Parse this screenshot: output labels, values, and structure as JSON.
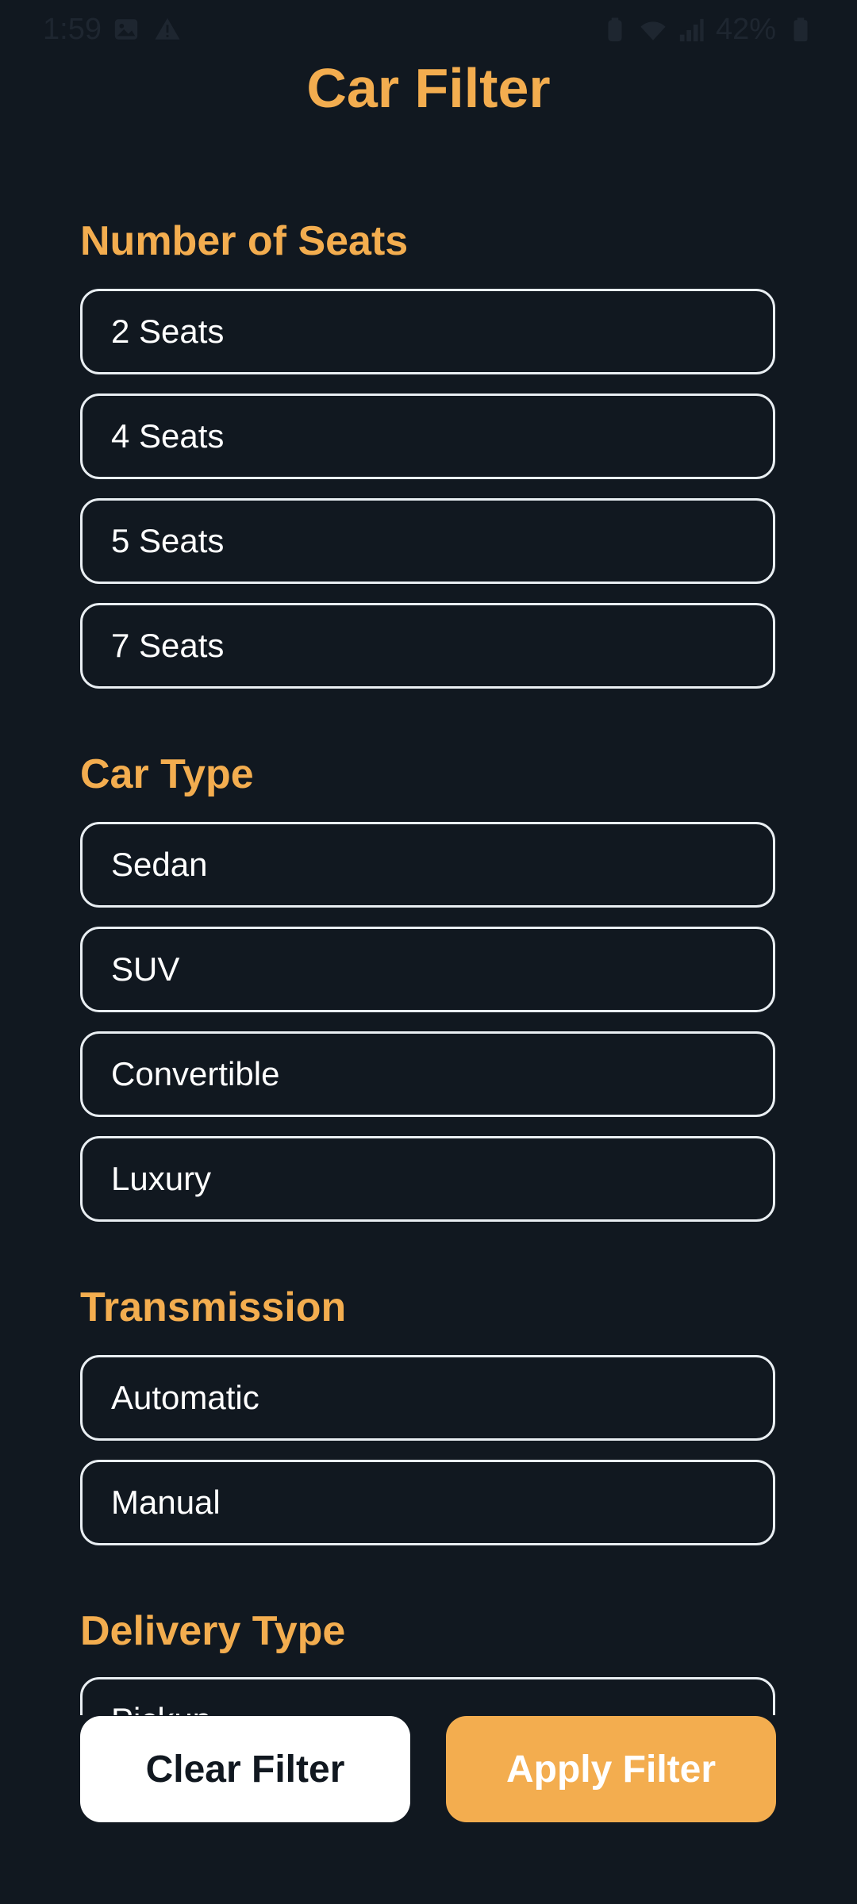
{
  "status_bar": {
    "time": "1:59",
    "battery": "42%"
  },
  "page": {
    "title": "Car Filter"
  },
  "sections": {
    "seats": {
      "heading": "Number of Seats",
      "options": [
        "2 Seats",
        "4 Seats",
        "5 Seats",
        "7 Seats"
      ]
    },
    "car_type": {
      "heading": "Car Type",
      "options": [
        "Sedan",
        "SUV",
        "Convertible",
        "Luxury"
      ]
    },
    "transmission": {
      "heading": "Transmission",
      "options": [
        "Automatic",
        "Manual"
      ]
    },
    "delivery": {
      "heading": "Delivery Type",
      "options": [
        "Pickup"
      ]
    }
  },
  "footer": {
    "clear_label": "Clear Filter",
    "apply_label": "Apply Filter"
  },
  "colors": {
    "background": "#111820",
    "accent": "#f3ad4f",
    "border": "#e9eef2"
  },
  "icons": [
    "image-icon",
    "warning-icon",
    "battery-saver-icon",
    "wifi-icon",
    "signal-icon",
    "battery-icon"
  ]
}
